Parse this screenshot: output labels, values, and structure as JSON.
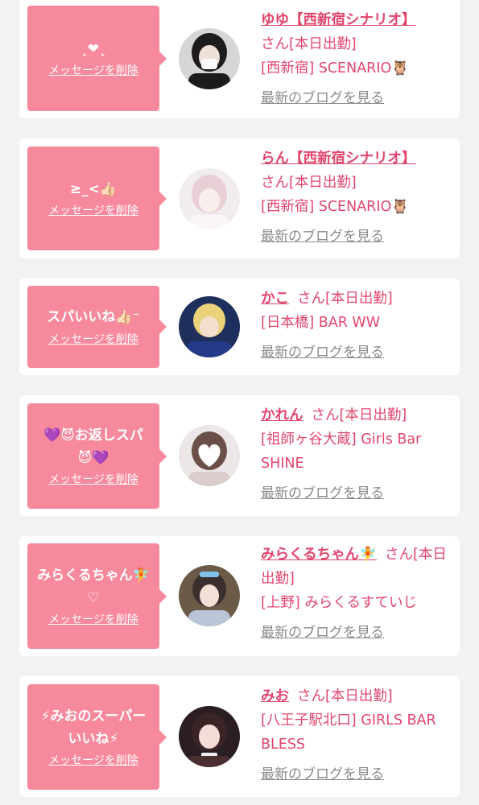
{
  "entries": [
    {
      "message": "˛❤˛",
      "delete_label": "メッセージを削除",
      "name": "ゆゆ【西新宿シナリオ】",
      "suffix": "さん[本日出勤]",
      "shop": "[西新宿] SCENARIO🦉",
      "blog_label": "最新のブログを見る"
    },
    {
      "message": "≥_<👍🏻",
      "delete_label": "メッセージを削除",
      "name": "らん【西新宿シナリオ】",
      "suffix": "さん[本日出勤]",
      "shop": "[西新宿] SCENARIO🦉",
      "blog_label": "最新のブログを見る"
    },
    {
      "message": "スパいいね👍🏻⁻",
      "delete_label": "メッセージを削除",
      "name": "かこ",
      "suffix": "さん[本日出勤]",
      "shop": "[日本橋] BAR WW",
      "blog_label": "最新のブログを見る"
    },
    {
      "message_line1": "💜😈お返しスパ",
      "message_line2": "😈💜",
      "delete_label": "メッセージを削除",
      "name": "かれん",
      "suffix": "さん[本日出勤]",
      "shop": "[祖師ヶ谷大蔵] Girls Bar SHINE",
      "blog_label": "最新のブログを見る"
    },
    {
      "message_line1": "みらくるちゃん🧚",
      "message_line2": "♡",
      "delete_label": "メッセージを削除",
      "name": "みらくるちゃん🧚",
      "suffix": "さん[本日出勤]",
      "shop": "[上野] みらくるすていじ",
      "blog_label": "最新のブログを見る"
    },
    {
      "message_line1": "⚡みおのスーパー",
      "message_line2": "いいね⚡",
      "delete_label": "メッセージを削除",
      "name": "みお",
      "suffix": "さん[本日出勤]",
      "shop": "[八王子駅北口] GIRLS BAR BLESS",
      "blog_label": "最新のブログを見る"
    }
  ]
}
